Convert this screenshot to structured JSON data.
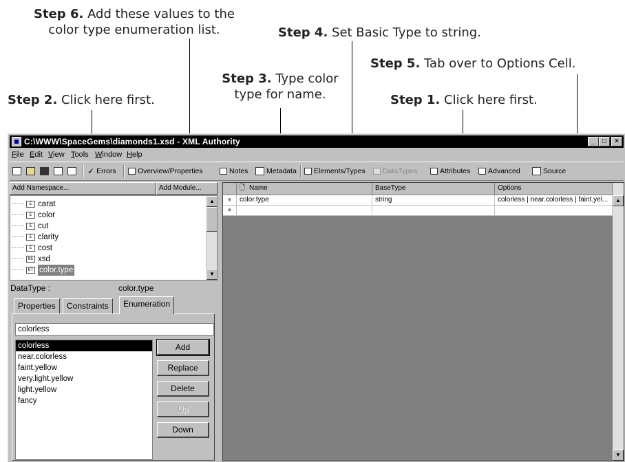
{
  "callouts": {
    "step6_label": "Step 6.",
    "step6_text1": "Add these values to the",
    "step6_text2": "color type enumeration list.",
    "step4_label": "Step 4.",
    "step4_text": "Set Basic Type to string.",
    "step5_label": "Step 5.",
    "step5_text": "Tab over to Options Cell.",
    "step3_label": "Step 3.",
    "step3_text1": "Type color",
    "step3_text2": "type for name.",
    "step2_label": "Step 2.",
    "step2_text": "Click here first.",
    "step1_label": "Step 1.",
    "step1_text": "Click here first."
  },
  "window": {
    "title": "C:\\WWW\\SpaceGems\\diamonds1.xsd - XML Authority"
  },
  "menu": [
    "File",
    "Edit",
    "View",
    "Tools",
    "Window",
    "Help"
  ],
  "toolbar": {
    "errors": "Errors",
    "overview": "Overview/Properties",
    "notes": "Notes",
    "metadata": "Metadata",
    "elements_types": "Elements/Types",
    "datatypes": "DataTypes",
    "attributes": "Attributes",
    "advanced": "Advanced",
    "source": "Source"
  },
  "left": {
    "add_namespace": "Add Namespace...",
    "add_module": "Add Module...",
    "tree": [
      {
        "icon": "E",
        "label": "carat"
      },
      {
        "icon": "E",
        "label": "color"
      },
      {
        "icon": "E",
        "label": "cut"
      },
      {
        "icon": "E",
        "label": "clarity"
      },
      {
        "icon": "E",
        "label": "cost"
      },
      {
        "icon": "NS",
        "label": "xsd"
      },
      {
        "icon": "DT",
        "label": "color.type"
      }
    ],
    "datatype_label": "DataType :",
    "datatype_name": "color.type",
    "tabs": [
      "Properties",
      "Constraints",
      "Enumeration"
    ],
    "enum_input": "colorless",
    "enum_values": [
      "colorless",
      "near.colorless",
      "faint.yellow",
      "very.light.yellow",
      "light.yellow",
      "fancy"
    ],
    "buttons": {
      "add": "Add",
      "replace": "Replace",
      "delete": "Delete",
      "up": "Up",
      "down": "Down"
    }
  },
  "grid": {
    "headers": [
      "Name",
      "BaseType",
      "Options"
    ],
    "rows": [
      {
        "name": "color.type",
        "basetype": "string",
        "options": "colorless | near.colorless | faint.yel..."
      },
      {
        "name": "",
        "basetype": "",
        "options": ""
      }
    ]
  }
}
